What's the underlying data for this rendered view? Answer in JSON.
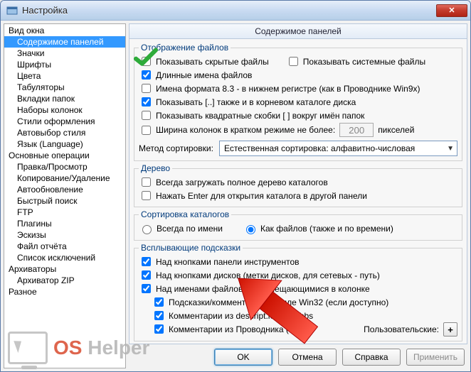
{
  "window": {
    "title": "Настройка",
    "icon": "app-icon"
  },
  "titlebar": {
    "close": "✕"
  },
  "tree": {
    "items": [
      {
        "label": "Вид окна",
        "level": 1,
        "selected": false
      },
      {
        "label": "Содержимое панелей",
        "level": 2,
        "selected": true
      },
      {
        "label": "Значки",
        "level": 2,
        "selected": false
      },
      {
        "label": "Шрифты",
        "level": 2,
        "selected": false
      },
      {
        "label": "Цвета",
        "level": 2,
        "selected": false
      },
      {
        "label": "Табуляторы",
        "level": 2,
        "selected": false
      },
      {
        "label": "Вкладки папок",
        "level": 2,
        "selected": false
      },
      {
        "label": "Наборы колонок",
        "level": 2,
        "selected": false
      },
      {
        "label": "Стили оформления",
        "level": 2,
        "selected": false
      },
      {
        "label": "Автовыбор стиля",
        "level": 2,
        "selected": false
      },
      {
        "label": "Язык (Language)",
        "level": 2,
        "selected": false
      },
      {
        "label": "Основные операции",
        "level": 1,
        "selected": false
      },
      {
        "label": "Правка/Просмотр",
        "level": 2,
        "selected": false
      },
      {
        "label": "Копирование/Удаление",
        "level": 2,
        "selected": false
      },
      {
        "label": "Автообновление",
        "level": 2,
        "selected": false
      },
      {
        "label": "Быстрый поиск",
        "level": 2,
        "selected": false
      },
      {
        "label": "FTP",
        "level": 2,
        "selected": false
      },
      {
        "label": "Плагины",
        "level": 2,
        "selected": false
      },
      {
        "label": "Эскизы",
        "level": 2,
        "selected": false
      },
      {
        "label": "Файл отчёта",
        "level": 2,
        "selected": false
      },
      {
        "label": "Список исключений",
        "level": 2,
        "selected": false
      },
      {
        "label": "Архиваторы",
        "level": 1,
        "selected": false
      },
      {
        "label": "Архиватор ZIP",
        "level": 2,
        "selected": false
      },
      {
        "label": "Разное",
        "level": 1,
        "selected": false
      }
    ]
  },
  "panel": {
    "heading": "Содержимое панелей",
    "files": {
      "legend": "Отображение файлов",
      "show_hidden": {
        "label": "Показывать скрытые файлы",
        "checked": false
      },
      "show_system": {
        "label": "Показывать системные файлы",
        "checked": false
      },
      "long_names": {
        "label": "Длинные имена файлов",
        "checked": true
      },
      "dos_names": {
        "label": "Имена формата 8.3 - в нижнем регистре (как в Проводнике Win9x)",
        "checked": false
      },
      "show_dotdot": {
        "label": "Показывать [..] также и в корневом каталоге диска",
        "checked": true
      },
      "square_brackets": {
        "label": "Показывать квадратные скобки [ ] вокруг имён папок",
        "checked": false
      },
      "col_width_label": "Ширина колонок в кратком режиме не более:",
      "col_width_value": "200",
      "pixels": "пикселей",
      "col_width_checked": false,
      "sort_label": "Метод сортировки:",
      "sort_value": "Естественная сортировка: алфавитно-числовая"
    },
    "tree": {
      "legend": "Дерево",
      "always_full": {
        "label": "Всегда загружать полное дерево каталогов",
        "checked": false
      },
      "enter_other": {
        "label": "Нажать Enter для открытия каталога в другой панели",
        "checked": false
      }
    },
    "sort": {
      "legend": "Сортировка каталогов",
      "by_name": "Всегда по имени",
      "like_files": "Как файлов (также и по времени)",
      "selected": "like_files"
    },
    "tooltips": {
      "legend": "Всплывающие подсказки",
      "toolbar": {
        "label": "Над кнопками панели инструментов",
        "checked": true
      },
      "drives": {
        "label": "Над кнопками дисков (метки дисков, для сетевых - путь)",
        "checked": true
      },
      "truncated": {
        "label": "Над именами файлов, не помещающимися в колонке",
        "checked": true
      },
      "win32": {
        "label": "Подсказки/комментарии в стиле Win32 (если доступно)",
        "checked": true
      },
      "descript": {
        "label": "Комментарии из descript.ion/files.bbs",
        "checked": true
      },
      "explorer": {
        "label": "Комментарии из Проводника (OLE2)",
        "checked": true
      },
      "custom_label": "Пользовательские:",
      "plus": "+"
    }
  },
  "buttons": {
    "ok": "OK",
    "cancel": "Отмена",
    "help": "Справка",
    "apply": "Применить"
  },
  "watermark": {
    "os": "OS",
    "helper": " Helper"
  }
}
